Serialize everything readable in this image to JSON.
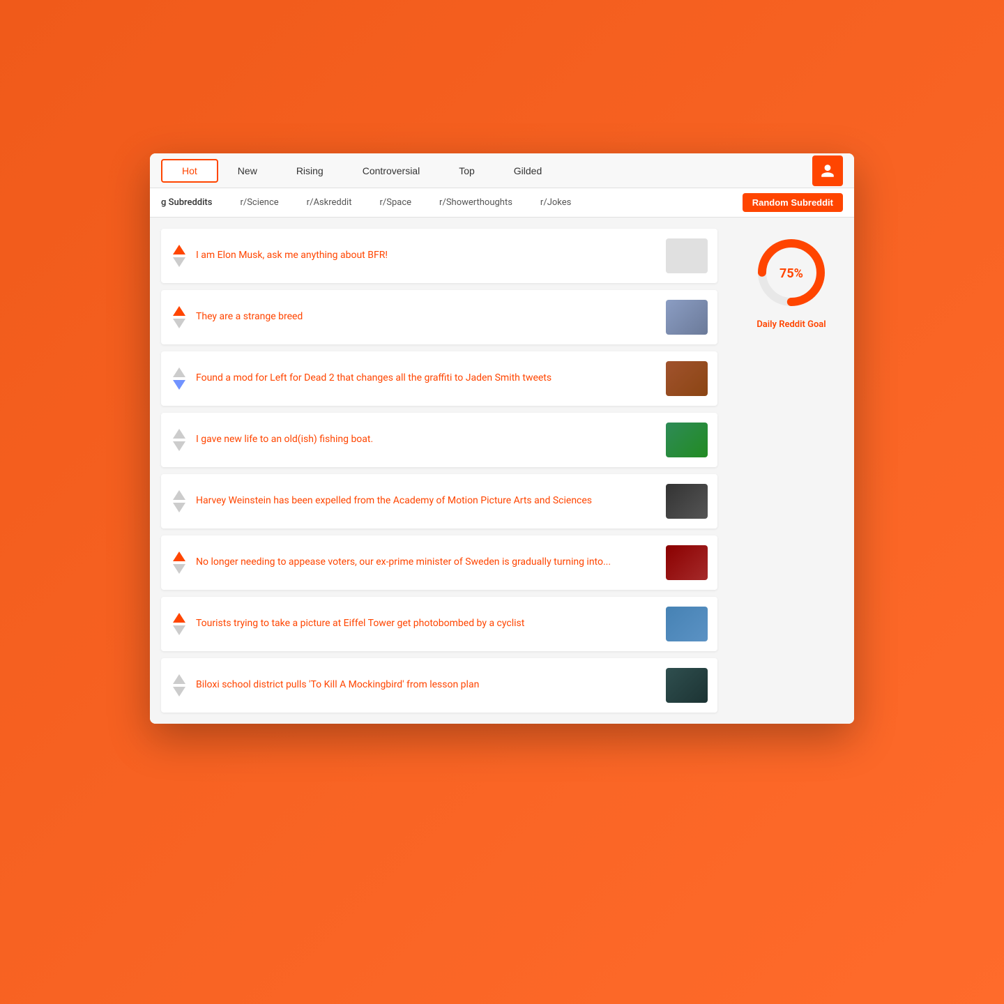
{
  "nav": {
    "tabs": [
      {
        "label": "Hot",
        "active": true
      },
      {
        "label": "New",
        "active": false
      },
      {
        "label": "Rising",
        "active": false
      },
      {
        "label": "Controversial",
        "active": false
      },
      {
        "label": "Top",
        "active": false
      },
      {
        "label": "Gilded",
        "active": false
      }
    ],
    "user_icon_label": "user"
  },
  "subreddit_bar": {
    "label": "g Subreddits",
    "links": [
      "r/Science",
      "r/Askreddit",
      "r/Space",
      "r/Showerthoughts",
      "r/Jokes"
    ],
    "random_button": "Random Subreddit"
  },
  "posts": [
    {
      "id": 1,
      "title": "I am Elon Musk, ask me anything about BFR!",
      "vote_state": "up",
      "has_thumb": false,
      "thumb_class": "blank"
    },
    {
      "id": 2,
      "title": "They are a strange breed",
      "vote_state": "up",
      "has_thumb": true,
      "thumb_class": "thumb-1"
    },
    {
      "id": 3,
      "title": "Found a mod for Left for Dead 2 that changes all the graffiti to Jaden Smith tweets",
      "vote_state": "down",
      "has_thumb": true,
      "thumb_class": "thumb-2"
    },
    {
      "id": 4,
      "title": "I gave new life to an old(ish) fishing boat.",
      "vote_state": "neutral",
      "has_thumb": true,
      "thumb_class": "thumb-3"
    },
    {
      "id": 5,
      "title": "Harvey Weinstein has been expelled from the Academy of Motion Picture Arts and Sciences",
      "vote_state": "neutral",
      "has_thumb": true,
      "thumb_class": "thumb-4"
    },
    {
      "id": 6,
      "title": "No longer needing to appease voters, our ex-prime minister of Sweden is gradually turning into...",
      "vote_state": "up",
      "has_thumb": true,
      "thumb_class": "thumb-5"
    },
    {
      "id": 7,
      "title": "Tourists trying to take a picture at Eiffel Tower get photobombed by a cyclist",
      "vote_state": "up",
      "has_thumb": true,
      "thumb_class": "thumb-6"
    },
    {
      "id": 8,
      "title": "Biloxi school district pulls 'To Kill A Mockingbird' from lesson plan",
      "vote_state": "neutral",
      "has_thumb": true,
      "thumb_class": "thumb-8"
    }
  ],
  "sidebar": {
    "donut_percent": 75,
    "donut_label": "Daily Reddit Goal",
    "donut_text": "75%",
    "donut_color": "#ff4500",
    "donut_bg": "#e8e8e8"
  }
}
